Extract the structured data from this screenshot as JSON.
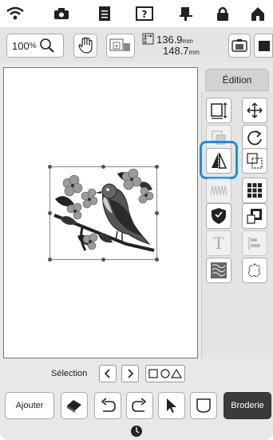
{
  "toolbar": {
    "zoom_value": "100",
    "zoom_unit": "%",
    "width_value": "136.9",
    "height_value": "148.7",
    "unit": "mm"
  },
  "edit_panel": {
    "tab_label": "Édition",
    "tool_text_glyph": "T"
  },
  "selection": {
    "label": "Sélection"
  },
  "bottom": {
    "add_label": "Ajouter",
    "embroidery_label": "Broderie"
  },
  "colors": {
    "highlight": "#1d8fe0",
    "dark_button": "#3a3a3a",
    "background": "#e8e8e8"
  }
}
